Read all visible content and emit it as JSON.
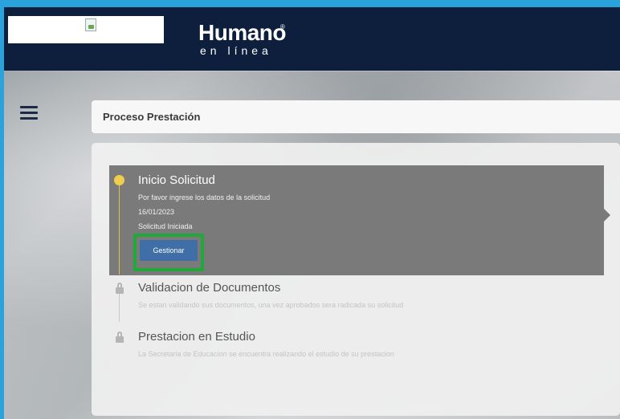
{
  "header": {
    "brand_name": "Humano",
    "brand_registered": "®",
    "brand_sub": "en línea"
  },
  "process": {
    "title": "Proceso Prestación"
  },
  "steps": [
    {
      "title": "Inicio Solicitud",
      "description": "Por favor ingrese los datos de la solicitud",
      "date": "16/01/2023",
      "status": "Solicitud Iniciada",
      "action_label": "Gestionar",
      "state": "active"
    },
    {
      "title": "Validacion de Documentos",
      "description": "Se estan validando sus documentos, una vez aprobados sera radicada su solicitud",
      "state": "locked"
    },
    {
      "title": "Prestacion en Estudio",
      "description": "La Secretaria de Educacion se encuentra realizando el estudio de su prestacion",
      "state": "locked"
    }
  ],
  "icons": {
    "menu": "hamburger-menu-icon",
    "broken_image": "broken-image-icon",
    "lock": "lock-icon"
  },
  "colors": {
    "header_bg": "#0d1f3c",
    "active_step_bg": "#7a7a7a",
    "active_dot": "#f1cd4f",
    "button_bg": "#3f6fa6",
    "highlight_border": "#22a83a"
  }
}
